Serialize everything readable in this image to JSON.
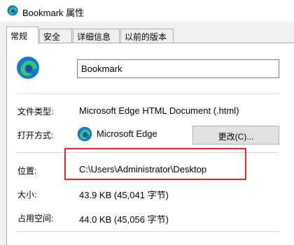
{
  "window": {
    "title": "Bookmark 属性",
    "icon": "edge-icon"
  },
  "tabs": [
    {
      "label": "常规",
      "active": true
    },
    {
      "label": "安全",
      "active": false
    },
    {
      "label": "详细信息",
      "active": false
    },
    {
      "label": "以前的版本",
      "active": false
    }
  ],
  "general": {
    "file_name": "Bookmark",
    "file_type_label": "文件类型:",
    "file_type_value": "Microsoft Edge HTML Document (.html)",
    "open_with_label": "打开方式:",
    "open_with_app": "Microsoft Edge",
    "change_button": "更改(C)...",
    "location_label": "位置:",
    "location_value": "C:\\Users\\Administrator\\Desktop",
    "size_label": "大小:",
    "size_value": "43.9 KB (45,041 字节)",
    "size_on_disk_label": "占用空间:",
    "size_on_disk_value": "44.0 KB (45,056 字节)"
  },
  "colors": {
    "highlight": "#e3262b",
    "edge_blue": "#0c59a4",
    "edge_green": "#3fc36a"
  }
}
